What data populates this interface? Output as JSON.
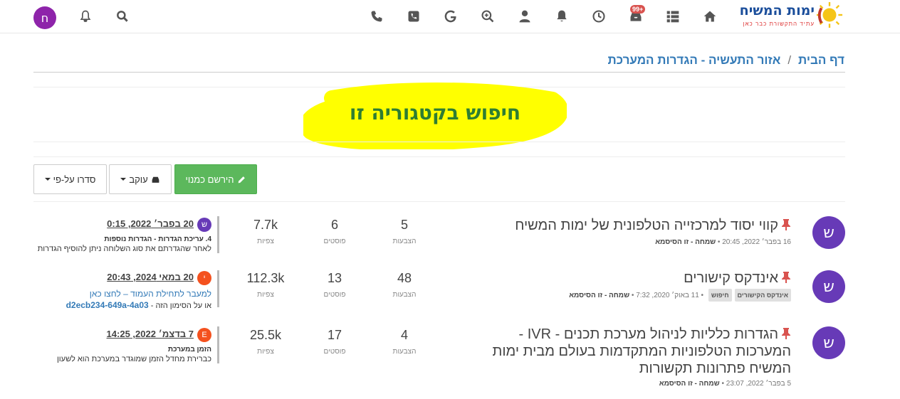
{
  "header": {
    "logo_title": "ימות המשיח",
    "logo_sub": "עתיד התקשורת כבר כאן",
    "notif_badge": "99+",
    "user_initial": "ח"
  },
  "breadcrumb": {
    "home": "דף הבית",
    "current": "אזור התעשיה - הגדרות המערכת"
  },
  "search_heading": "חיפוש בקטגוריה זו",
  "buttons": {
    "register": "הירשם כמנוי",
    "watch": "עוקב",
    "sort": "סדרו על-פי"
  },
  "topics": [
    {
      "avatar": "ש",
      "title": "קווי יסוד למרכזייה הטלפונית של ימות המשיח",
      "date": "16 בפבר׳ 2022, 20:45",
      "author": "שמחה - זו הסיסמא",
      "tags": [],
      "votes": "5",
      "posts": "6",
      "views": "7.7k",
      "labels": {
        "votes": "הצבעות",
        "posts": "פוסטים",
        "views": "צפיות"
      },
      "last": {
        "avatar": "ש",
        "avatar_color": "#673ab7",
        "when": "20 בפבר׳ 2022, 0:15",
        "line2": "4. עריכת הגדרות - הגדרות נוספות",
        "line3": "לאחר שהגדרתם את סוג השלוחה ניתן להוסיף הגדרות"
      }
    },
    {
      "avatar": "ש",
      "title": "אינדקס קישורים",
      "date": "11 באוק׳ 2020, 7:32",
      "author": "שמחה - זו הסיסמא",
      "tags": [
        "אינדקס הקישורים",
        "חיפוש"
      ],
      "votes": "48",
      "posts": "13",
      "views": "112.3k",
      "labels": {
        "votes": "הצבעות",
        "posts": "פוסטים",
        "views": "צפיות"
      },
      "last": {
        "avatar": "י",
        "avatar_color": "#f4511e",
        "when": "20 במאי 2024, 20:43",
        "line2": "למעבר לתחילת העמוד – לחצו כאן",
        "line3_prefix": "או על הסימון הזה -",
        "line3_link": "d2ecb234-649a-4a03"
      }
    },
    {
      "avatar": "ש",
      "title": "הגדרות כלליות לניהול מערכת תכנים - IVR - המערכות הטלפוניות המתקדמות בעולם מבית ימות המשיח פתרונות תקשורות",
      "date": "5 בפבר׳ 2022, 23:07",
      "author": "שמחה - זו הסיסמא",
      "tags": [],
      "votes": "4",
      "posts": "17",
      "views": "25.5k",
      "labels": {
        "votes": "הצבעות",
        "posts": "פוסטים",
        "views": "צפיות"
      },
      "last": {
        "avatar": "E",
        "avatar_color": "#f4511e",
        "when": "7 בדצמ׳ 2022, 14:25",
        "line2": "הזמן במערכת",
        "line3": "כברירת מחדל הזמן שמוגדר במערכת הוא לשעון"
      }
    }
  ],
  "colors": {
    "accent_link": "#337ab7",
    "register_button": "#5cb85c",
    "topic_avatar": "#673ab7",
    "highlight": "#ffff00",
    "heading_green": "#2e7d32"
  }
}
